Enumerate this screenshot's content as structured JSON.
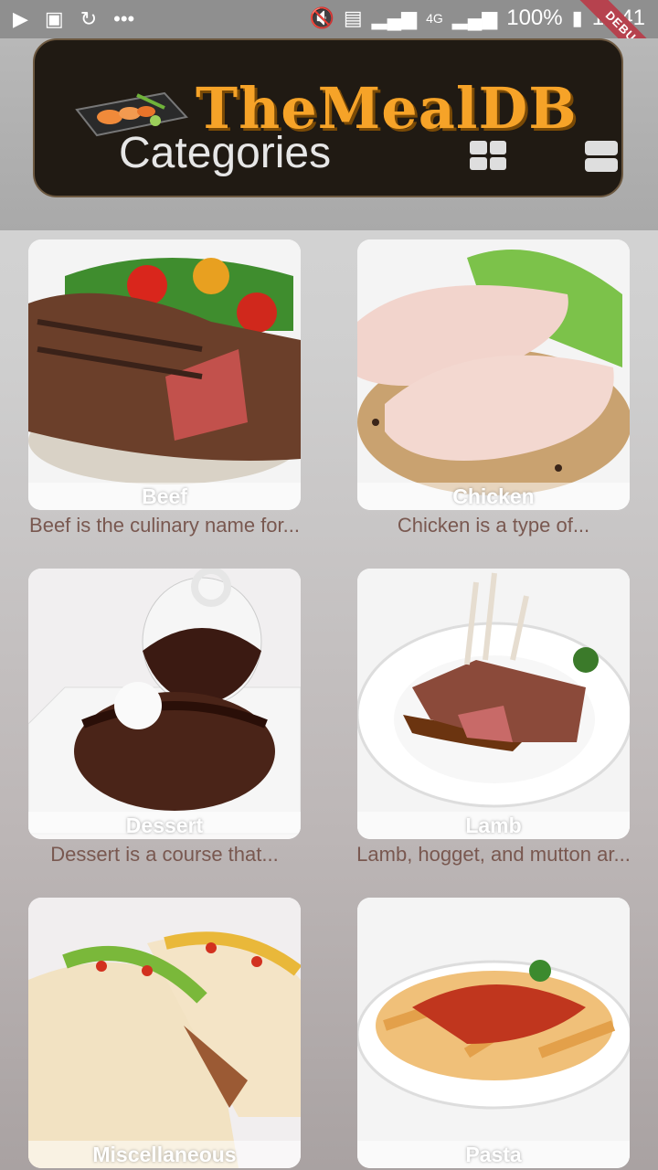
{
  "status_bar": {
    "battery": "100%",
    "time": "11:41",
    "network": "4G",
    "icons": [
      "play-icon",
      "flipboard-icon",
      "refresh-icon",
      "more-icon",
      "mute-icon",
      "sim-icon",
      "signal-icon",
      "battery-icon"
    ],
    "debug_label": "DEBUG"
  },
  "header": {
    "logo_text": "TheMealDB",
    "title": "Categories",
    "grid_view_icon": "grid-view-icon",
    "list_view_icon": "list-view-icon"
  },
  "categories": [
    {
      "name": "Beef",
      "description": "Beef is the culinary name for..."
    },
    {
      "name": "Chicken",
      "description": "Chicken is a type of..."
    },
    {
      "name": "Dessert",
      "description": "Dessert is a course that..."
    },
    {
      "name": "Lamb",
      "description": "Lamb, hogget, and mutton ar..."
    },
    {
      "name": "Miscellaneous",
      "description": ""
    },
    {
      "name": "Pasta",
      "description": ""
    }
  ],
  "colors": {
    "logo": "#f6a328",
    "header_bg": "#201a13",
    "description": "#795850"
  }
}
